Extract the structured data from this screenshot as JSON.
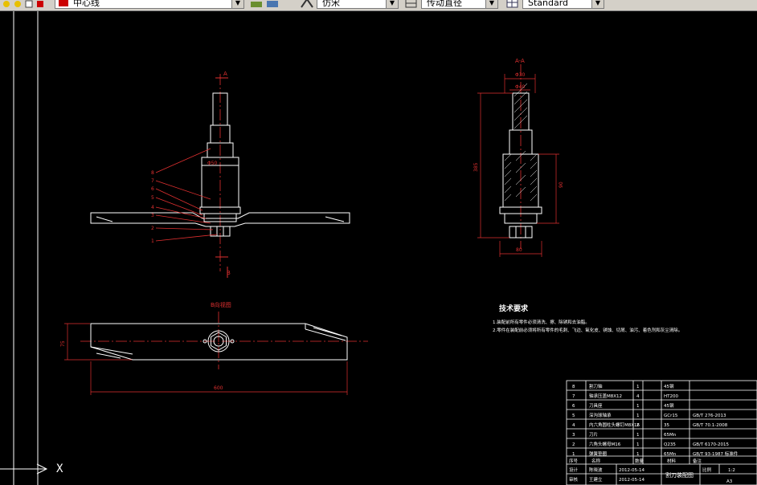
{
  "toolbar": {
    "layer_name": "中心线",
    "text_style": "仿宋",
    "dim_style": "传动直径",
    "table_style": "Standard"
  },
  "drawing": {
    "section_label": "A-A",
    "view_label": "B向视图",
    "tech_req": {
      "title": "技术要求",
      "line1": "1.装配前所有零件必须清洗、擦、除锈和去油脂。",
      "line2": "2.零件在装配前必须将所有零件的毛刺、飞边、氧化皮、锈蚀、切屑、油污、着色剂和灰尘清除。"
    },
    "dims": {
      "top_width": "Φ30",
      "sleeve": "Φ50",
      "height_total": "385",
      "height_lower": "90",
      "base_width": "80",
      "blade_length": "600",
      "blade_width": "75",
      "hub": "Φ40"
    },
    "markers": {
      "a1": "A",
      "a2": "A",
      "b1": "B"
    },
    "callouts": [
      "8",
      "7",
      "6",
      "5",
      "4",
      "3",
      "2",
      "1"
    ]
  },
  "title_block": {
    "rows": [
      {
        "no": "8",
        "name": "割刀轴",
        "qty": "1",
        "mat": "45钢",
        "std": ""
      },
      {
        "no": "7",
        "name": "轴承压盖M8X12",
        "qty": "4",
        "mat": "HT200",
        "std": ""
      },
      {
        "no": "6",
        "name": "刀具座",
        "qty": "1",
        "mat": "45钢",
        "std": ""
      },
      {
        "no": "5",
        "name": "深沟球轴承",
        "qty": "1",
        "mat": "GCr15",
        "std": "GB/T 276-2013"
      },
      {
        "no": "4",
        "name": "内六角圆柱头螺钉M8X16",
        "qty": "2",
        "mat": "35",
        "std": "GB/T 70.1-2008"
      },
      {
        "no": "3",
        "name": "刀片",
        "qty": "1",
        "mat": "65Mn",
        "std": ""
      },
      {
        "no": "2",
        "name": "六角头螺母M16",
        "qty": "1",
        "mat": "Q235",
        "std": "GB/T 6170-2015"
      },
      {
        "no": "1",
        "name": "弹簧垫圈",
        "qty": "1",
        "mat": "65Mn",
        "std": "GB/T 93-1987 标准件"
      }
    ],
    "header": {
      "no": "序号",
      "name": "名称",
      "qty": "数量",
      "mat": "材料",
      "std": "备注"
    },
    "designer_label": "设计",
    "designer": "陈晓波",
    "design_date": "2012-05-14",
    "checker_label": "审核",
    "checker": "王建立",
    "check_date": "2012-05-14",
    "drawing_name": "割刀装配图",
    "scale_label": "比例",
    "scale": "1:2",
    "sheet": "A3"
  },
  "status": {
    "prompt_glyph": "X"
  }
}
